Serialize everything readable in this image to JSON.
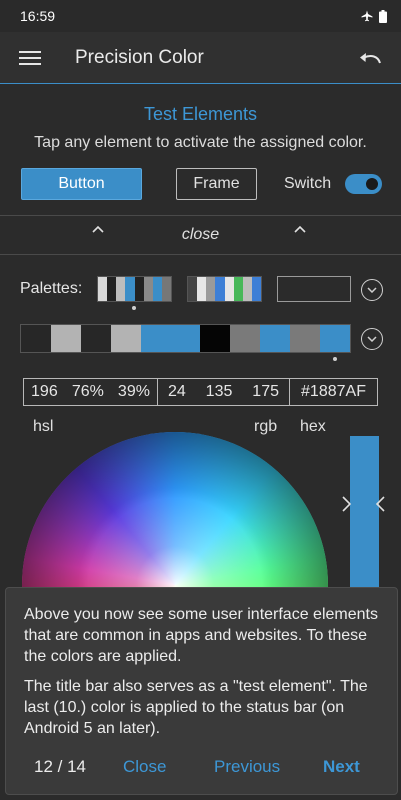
{
  "status_bar": {
    "time": "16:59",
    "icons": [
      "airplane-icon",
      "battery-icon"
    ]
  },
  "app_bar": {
    "title": "Precision Color",
    "menu_icon": "hamburger-menu-icon",
    "undo_icon": "undo-icon",
    "accent": "#3b8ec8"
  },
  "test_elements": {
    "title": "Test Elements",
    "description": "Tap any element to activate the assigned color.",
    "button_label": "Button",
    "frame_label": "Frame",
    "switch_label": "Switch",
    "switch_on": true
  },
  "collapse_row": {
    "label": "close"
  },
  "palettes": {
    "label": "Palettes:",
    "palette_1": [
      "#d9d9d9",
      "#222222",
      "#bdbdbd",
      "#3b8ec8",
      "#222222",
      "#8a8a8a",
      "#3b8ec8",
      "#777777"
    ],
    "palette_2": [
      "#444444",
      "#e6e6e6",
      "#9a9a9a",
      "#3d7fd6",
      "#e6e6e6",
      "#47b85a",
      "#bdbdbd",
      "#3d7fd6"
    ],
    "palette_3": []
  },
  "current_palette": [
    "#272727",
    "#b3b3b3",
    "#272727",
    "#b3b3b3",
    "#3b8ec8",
    "#3b8ec8",
    "#050505",
    "#7a7a7a",
    "#3b8ec8",
    "#7a7a7a",
    "#3b8ec8"
  ],
  "values": {
    "hsl": [
      "196",
      "76%",
      "39%"
    ],
    "rgb": [
      "24",
      "135",
      "175"
    ],
    "hex": "#1887AF"
  },
  "mode_labels": {
    "hsl": "hsl",
    "rgb": "rgb",
    "hex": "hex"
  },
  "tutorial": {
    "paragraph_1": "Above you now see some user interface elements that are common in apps and websites. To these the colors are applied.",
    "paragraph_2": "The title bar also serves as a \"test element\". The last (10.) color is applied to the status bar (on Android 5 an later).",
    "counter": "12 / 14",
    "close_label": "Close",
    "previous_label": "Previous",
    "next_label": "Next"
  }
}
